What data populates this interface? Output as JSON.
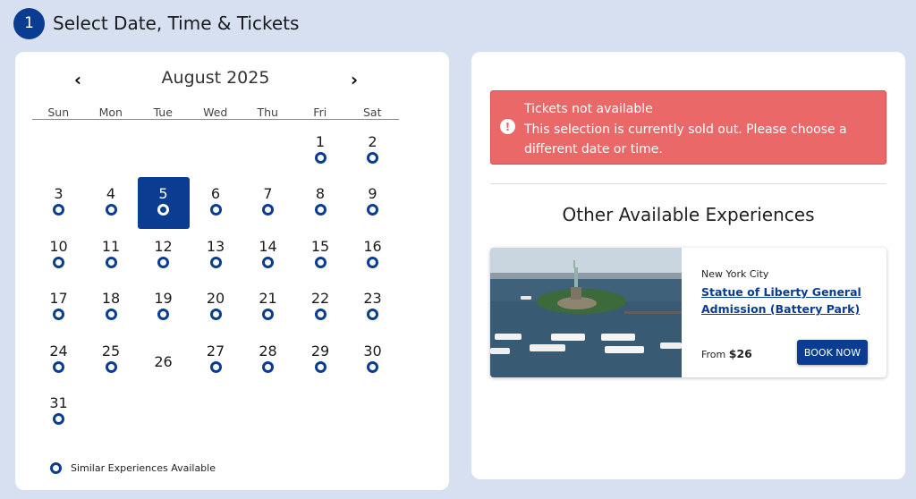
{
  "step": {
    "number": "1",
    "title": "Select Date, Time & Tickets"
  },
  "calendar": {
    "month_label": "August 2025",
    "prev_icon": "‹",
    "next_icon": "›",
    "weekdays": [
      "Sun",
      "Mon",
      "Tue",
      "Wed",
      "Thu",
      "Fri",
      "Sat"
    ],
    "selected_day": "5",
    "days_without_availability": [
      "26"
    ],
    "days": [
      "1",
      "2",
      "3",
      "4",
      "5",
      "6",
      "7",
      "8",
      "9",
      "10",
      "11",
      "12",
      "13",
      "14",
      "15",
      "16",
      "17",
      "18",
      "19",
      "20",
      "21",
      "22",
      "23",
      "24",
      "25",
      "26",
      "27",
      "28",
      "29",
      "30",
      "31"
    ],
    "legend": "Similar Experiences Available"
  },
  "alert": {
    "icon": "!",
    "title": "Tickets not available",
    "message": "This selection is currently sold out. Please choose a different date or time."
  },
  "other": {
    "heading": "Other Available Experiences",
    "experience": {
      "city": "New York City",
      "name": "Statue of Liberty General Admission (Battery Park)",
      "price_prefix": "From",
      "price": "$26",
      "button": "BOOK NOW"
    }
  },
  "colors": {
    "primary": "#0a3d91",
    "alert": "#ea6868",
    "background": "#d6e0f1"
  }
}
